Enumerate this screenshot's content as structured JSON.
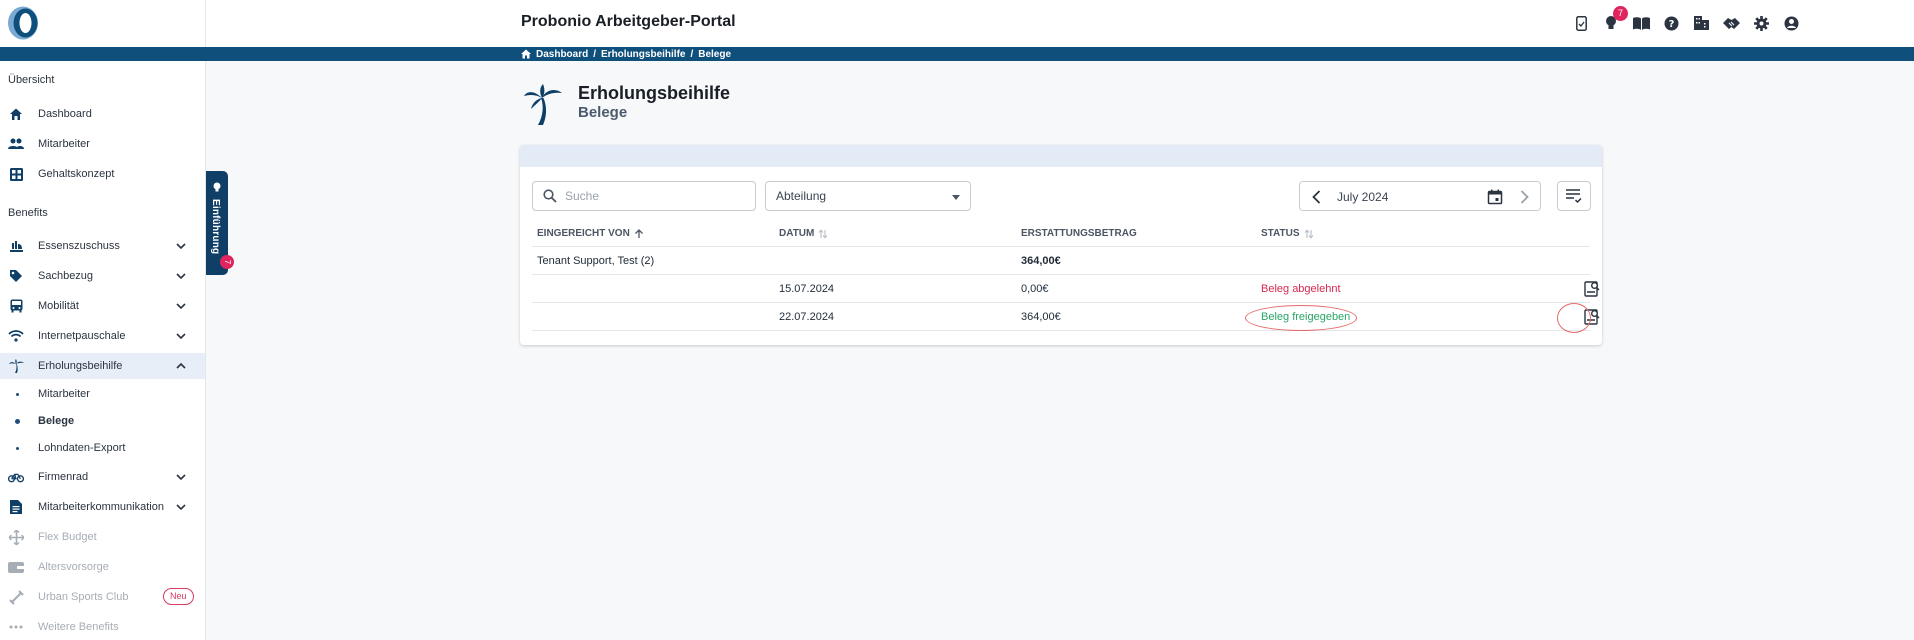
{
  "header": {
    "app_title": "Probonio Arbeitgeber-Portal",
    "notification_count": "7",
    "icons": [
      "phone-icon",
      "lightbulb-icon",
      "book-icon",
      "help-icon",
      "building-icon",
      "handshake-icon",
      "gear-icon",
      "account-icon"
    ]
  },
  "breadcrumb": {
    "items": [
      "Dashboard",
      "Erholungsbeihilfe",
      "Belege"
    ],
    "separator": "/"
  },
  "sidebar": {
    "section_overview": "Übersicht",
    "section_benefits": "Benefits",
    "overview_items": [
      {
        "label": "Dashboard",
        "icon": "home-icon"
      },
      {
        "label": "Mitarbeiter",
        "icon": "people-icon"
      },
      {
        "label": "Gehaltskonzept",
        "icon": "table-icon"
      }
    ],
    "benefit_items": [
      {
        "label": "Essenszuschuss",
        "icon": "food-icon"
      },
      {
        "label": "Sachbezug",
        "icon": "tag-icon"
      },
      {
        "label": "Mobilität",
        "icon": "bus-icon"
      },
      {
        "label": "Internetpauschale",
        "icon": "wifi-icon"
      },
      {
        "label": "Erholungsbeihilfe",
        "icon": "palm-icon"
      }
    ],
    "sub_items": [
      "Mitarbeiter",
      "Belege",
      "Lohndaten-Export"
    ],
    "more_items": [
      {
        "label": "Firmenrad",
        "icon": "bike-icon"
      },
      {
        "label": "Mitarbeiterkommunikation",
        "icon": "document-icon"
      }
    ],
    "disabled_items": [
      {
        "label": "Flex Budget",
        "icon": "flex-icon"
      },
      {
        "label": "Altersvorsorge",
        "icon": "wallet-icon"
      },
      {
        "label": "Urban Sports Club",
        "icon": "dumbbell-icon"
      },
      {
        "label": "Weitere Benefits",
        "icon": "more-icon"
      }
    ],
    "neu_badge": "Neu"
  },
  "intro_tab": {
    "label": "Einführung",
    "badge": "7"
  },
  "page": {
    "title": "Erholungsbeihilfe",
    "subtitle": "Belege"
  },
  "filters": {
    "search_placeholder": "Suche",
    "department_label": "Abteilung",
    "month": "July 2024"
  },
  "table": {
    "columns": [
      "EINGEREICHT VON",
      "DATUM",
      "ERSTATTUNGSBETRAG",
      "STATUS"
    ],
    "group": {
      "name": "Tenant Support, Test (2)",
      "total": "364,00€"
    },
    "rows": [
      {
        "date": "15.07.2024",
        "amount": "0,00€",
        "status": "Beleg abgelehnt"
      },
      {
        "date": "22.07.2024",
        "amount": "364,00€",
        "status": "Beleg freigegeben"
      }
    ]
  },
  "colors": {
    "primary": "#0f4f7c",
    "accent_red": "#d6294f",
    "accent_green": "#2aa566",
    "badge": "#e0245e",
    "annotation": "#e56a6a"
  }
}
